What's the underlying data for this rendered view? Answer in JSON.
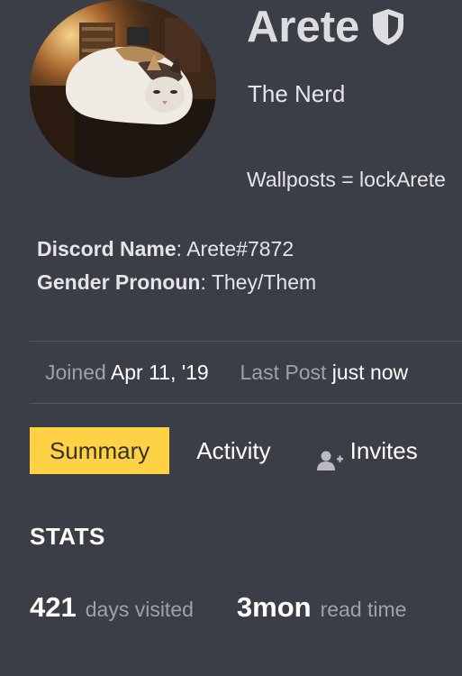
{
  "profile": {
    "username": "Arete",
    "title": "The Nerd",
    "bio": "Wallposts = lockArete",
    "badge_icon": "shield-icon",
    "avatar": "cat-photo"
  },
  "fields": [
    {
      "label": "Discord Name",
      "value": "Arete#7872"
    },
    {
      "label": "Gender Pronoun",
      "value": "They/Them"
    }
  ],
  "meta": {
    "joined_label": "Joined",
    "joined_value": "Apr 11, '19",
    "last_post_label": "Last Post",
    "last_post_value": "just now"
  },
  "tabs": [
    {
      "label": "Summary",
      "active": true
    },
    {
      "label": "Activity",
      "active": false
    },
    {
      "label": "Invites",
      "active": false,
      "icon": "add-user-icon"
    }
  ],
  "stats": {
    "heading": "STATS",
    "items": [
      {
        "value": "421",
        "label": "days visited"
      },
      {
        "value": "3mon",
        "label": "read time"
      }
    ]
  },
  "colors": {
    "background": "#3b3e46",
    "accent": "#ffd144",
    "muted_text": "#9ea1a8",
    "divider": "#565962"
  }
}
